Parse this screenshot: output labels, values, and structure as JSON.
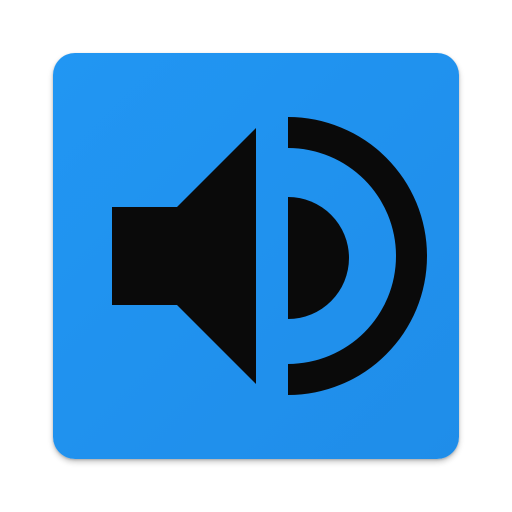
{
  "app_icon": {
    "name": "speaker-volume-app-icon",
    "icon": "speaker-volume-icon",
    "colors": {
      "background": "#2196f3",
      "glyph": "#0a0a0a"
    }
  }
}
